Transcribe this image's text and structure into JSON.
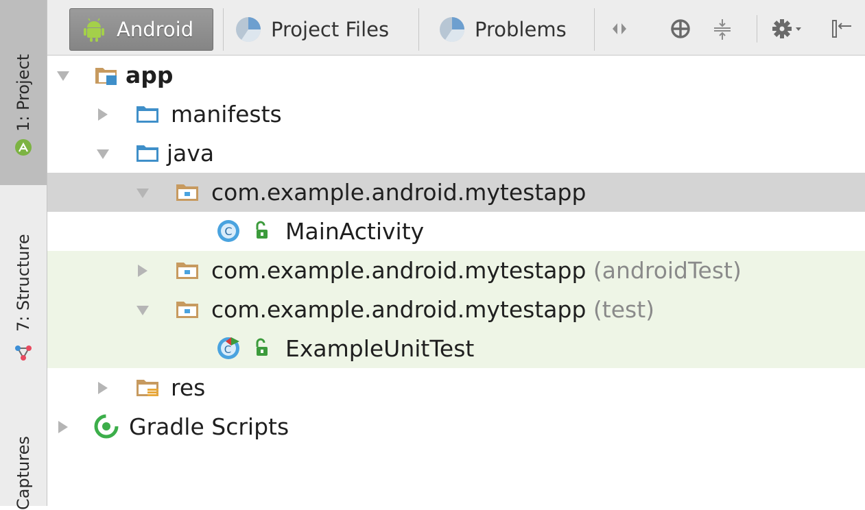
{
  "side_panel": {
    "tabs": [
      {
        "label": "1: Project",
        "icon": "android-icon",
        "active": true
      },
      {
        "label": "7: Structure",
        "icon": "structure-icon",
        "active": false
      },
      {
        "label": "Captures",
        "icon": "",
        "active": false
      }
    ]
  },
  "toolbar": {
    "tabs": [
      {
        "label": "Android",
        "icon": "android-icon",
        "selected": true
      },
      {
        "label": "Project Files",
        "icon": "pie-icon",
        "selected": false
      },
      {
        "label": "Problems",
        "icon": "pie-icon",
        "selected": false
      }
    ],
    "icons": [
      "scroll-tabs-icon",
      "locate-icon",
      "collapse-all-icon",
      "settings-icon",
      "hide-panel-icon"
    ]
  },
  "tree": [
    {
      "label": "app",
      "suffix": "",
      "expanded": true,
      "icon": "module-folder-icon"
    },
    {
      "label": "manifests",
      "suffix": "",
      "expanded": false,
      "icon": "folder-icon"
    },
    {
      "label": "java",
      "suffix": "",
      "expanded": true,
      "icon": "folder-icon"
    },
    {
      "label": "com.example.android.mytestapp",
      "suffix": "",
      "expanded": true,
      "icon": "package-icon",
      "selected": true
    },
    {
      "label": "MainActivity",
      "suffix": "",
      "icon": "class-icon"
    },
    {
      "label": "com.example.android.mytestapp",
      "suffix": "(androidTest)",
      "expanded": false,
      "icon": "package-icon"
    },
    {
      "label": "com.example.android.mytestapp",
      "suffix": "(test)",
      "expanded": true,
      "icon": "package-icon"
    },
    {
      "label": "ExampleUnitTest",
      "suffix": "",
      "icon": "test-class-icon"
    },
    {
      "label": "res",
      "suffix": "",
      "expanded": false,
      "icon": "resource-folder-icon"
    },
    {
      "label": "Gradle Scripts",
      "suffix": "",
      "expanded": false,
      "icon": "gradle-icon"
    }
  ],
  "colors": {
    "selected_row": "#d4d4d4",
    "test_rows": "#eef5e6",
    "folder_blue": "#3f8fc9",
    "package_tan": "#c79a5f",
    "class_blue": "#4aa3df",
    "unlocked_green": "#3c9b3c"
  }
}
